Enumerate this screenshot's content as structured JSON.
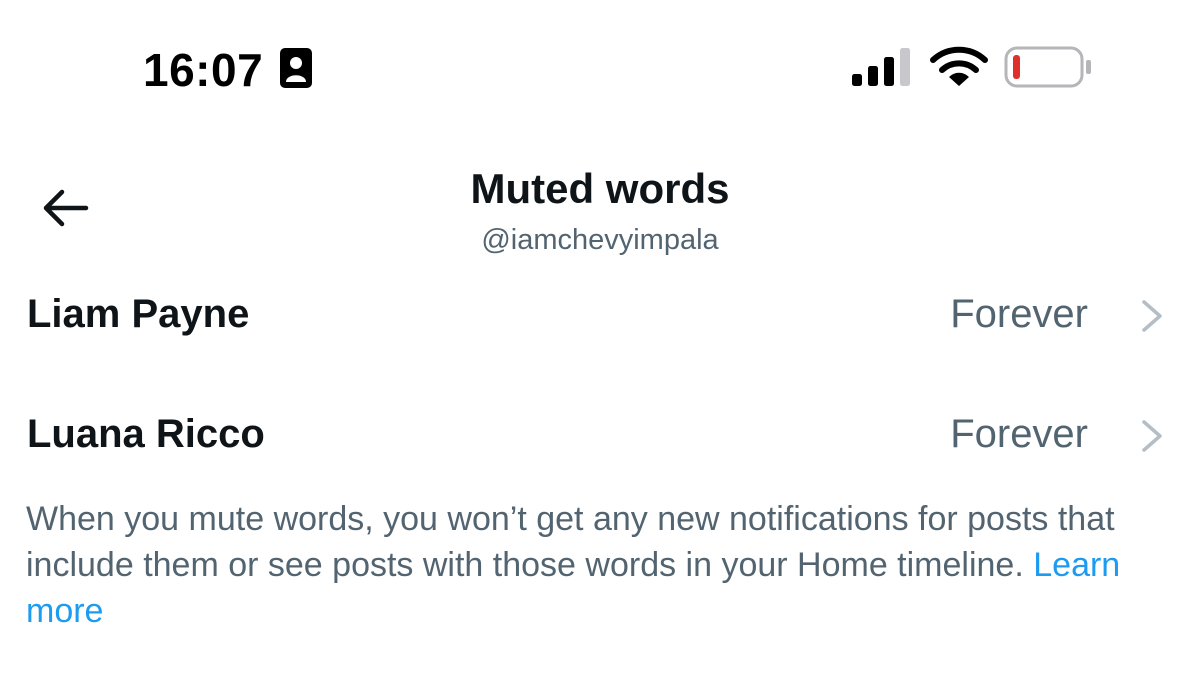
{
  "status_bar": {
    "time": "16:07",
    "icons": [
      "focus-badge-icon",
      "cellular-signal-icon",
      "wifi-icon",
      "battery-low-icon"
    ],
    "battery_fill_color": "#e0302c"
  },
  "header": {
    "title": "Muted words",
    "subtitle": "@iamchevyimpala",
    "back_icon": "arrow-left-icon"
  },
  "muted_words": [
    {
      "word": "Liam Payne",
      "duration": "Forever"
    },
    {
      "word": "Luana Ricco",
      "duration": "Forever"
    }
  ],
  "info": {
    "text": "When you mute words, you won’t get any new notifications for posts that include them or see posts with those words in your Home timeline.",
    "link_text": "Learn more",
    "link_color": "#1d9bf0"
  },
  "colors": {
    "primary_text": "#0f1419",
    "secondary_text": "#536471",
    "accent": "#1d9bf0"
  }
}
